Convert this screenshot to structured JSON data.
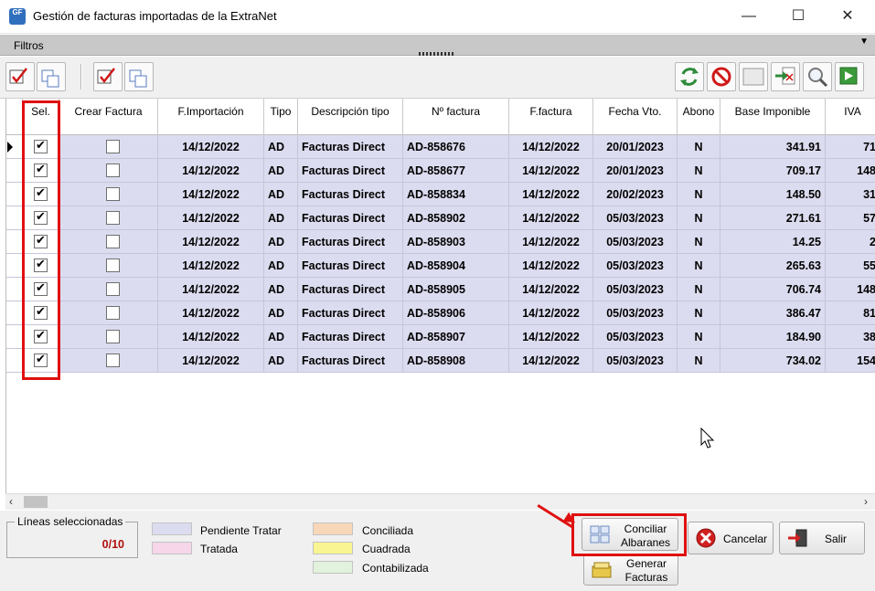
{
  "window": {
    "title": "Gestión de facturas importadas de la ExtraNet",
    "app_icon_text": "GF",
    "controls": {
      "minimize": "—",
      "maximize": "☐",
      "close": "✕"
    }
  },
  "filters_bar": {
    "label": "Filtros",
    "toggle_glyph": "▼"
  },
  "toolbar": {
    "left_icons": [
      "select-all-icon",
      "deselect-all-icon",
      "check-invoice-icon",
      "uncheck-invoice-icon"
    ],
    "right_icons": [
      "refresh-icon",
      "cancel-icon",
      "blank-icon",
      "export-pdf-icon",
      "search-icon",
      "exit-icon"
    ]
  },
  "grid": {
    "columns": [
      "Sel.",
      "Crear Factura",
      "F.Importación",
      "Tipo",
      "Descripción tipo",
      "Nº factura",
      "F.factura",
      "Fecha Vto.",
      "Abono",
      "Base Imponible",
      "IVA"
    ],
    "rows": [
      {
        "sel": true,
        "crear": false,
        "f_importacion": "14/12/2022",
        "tipo": "AD",
        "descripcion": "Facturas Direct",
        "numero": "AD-858676",
        "f_factura": "14/12/2022",
        "fecha_vto": "20/01/2023",
        "abono": "N",
        "base": "341.91",
        "iva": "71"
      },
      {
        "sel": true,
        "crear": false,
        "f_importacion": "14/12/2022",
        "tipo": "AD",
        "descripcion": "Facturas Direct",
        "numero": "AD-858677",
        "f_factura": "14/12/2022",
        "fecha_vto": "20/01/2023",
        "abono": "N",
        "base": "709.17",
        "iva": "148"
      },
      {
        "sel": true,
        "crear": false,
        "f_importacion": "14/12/2022",
        "tipo": "AD",
        "descripcion": "Facturas Direct",
        "numero": "AD-858834",
        "f_factura": "14/12/2022",
        "fecha_vto": "20/02/2023",
        "abono": "N",
        "base": "148.50",
        "iva": "31"
      },
      {
        "sel": true,
        "crear": false,
        "f_importacion": "14/12/2022",
        "tipo": "AD",
        "descripcion": "Facturas Direct",
        "numero": "AD-858902",
        "f_factura": "14/12/2022",
        "fecha_vto": "05/03/2023",
        "abono": "N",
        "base": "271.61",
        "iva": "57"
      },
      {
        "sel": true,
        "crear": false,
        "f_importacion": "14/12/2022",
        "tipo": "AD",
        "descripcion": "Facturas Direct",
        "numero": "AD-858903",
        "f_factura": "14/12/2022",
        "fecha_vto": "05/03/2023",
        "abono": "N",
        "base": "14.25",
        "iva": "2"
      },
      {
        "sel": true,
        "crear": false,
        "f_importacion": "14/12/2022",
        "tipo": "AD",
        "descripcion": "Facturas Direct",
        "numero": "AD-858904",
        "f_factura": "14/12/2022",
        "fecha_vto": "05/03/2023",
        "abono": "N",
        "base": "265.63",
        "iva": "55"
      },
      {
        "sel": true,
        "crear": false,
        "f_importacion": "14/12/2022",
        "tipo": "AD",
        "descripcion": "Facturas Direct",
        "numero": "AD-858905",
        "f_factura": "14/12/2022",
        "fecha_vto": "05/03/2023",
        "abono": "N",
        "base": "706.74",
        "iva": "148"
      },
      {
        "sel": true,
        "crear": false,
        "f_importacion": "14/12/2022",
        "tipo": "AD",
        "descripcion": "Facturas Direct",
        "numero": "AD-858906",
        "f_factura": "14/12/2022",
        "fecha_vto": "05/03/2023",
        "abono": "N",
        "base": "386.47",
        "iva": "81"
      },
      {
        "sel": true,
        "crear": false,
        "f_importacion": "14/12/2022",
        "tipo": "AD",
        "descripcion": "Facturas Direct",
        "numero": "AD-858907",
        "f_factura": "14/12/2022",
        "fecha_vto": "05/03/2023",
        "abono": "N",
        "base": "184.90",
        "iva": "38"
      },
      {
        "sel": true,
        "crear": false,
        "f_importacion": "14/12/2022",
        "tipo": "AD",
        "descripcion": "Facturas Direct",
        "numero": "AD-858908",
        "f_factura": "14/12/2022",
        "fecha_vto": "05/03/2023",
        "abono": "N",
        "base": "734.02",
        "iva": "154"
      }
    ]
  },
  "scrollbar": {
    "left": "‹",
    "right": "›"
  },
  "footer": {
    "selected_label": "Líneas seleccionadas",
    "selected_count": "0/10",
    "legend": [
      {
        "label": "Pendiente Tratar",
        "color": "#dcdcf0"
      },
      {
        "label": "Tratada",
        "color": "#f6d6e8"
      },
      {
        "label": "Conciliada",
        "color": "#f8d7b8"
      },
      {
        "label": "Cuadrada",
        "color": "#f8f592"
      },
      {
        "label": "Contabilizada",
        "color": "#e2f2dc"
      }
    ],
    "buttons": {
      "conciliar_1": "Conciliar",
      "conciliar_2": "Albaranes",
      "generar_1": "Generar",
      "generar_2": "Facturas",
      "cancelar": "Cancelar",
      "salir": "Salir"
    }
  },
  "colors": {
    "row_bg": "#dcdcf0",
    "highlight": "#e01010",
    "count_text": "#b01010"
  }
}
